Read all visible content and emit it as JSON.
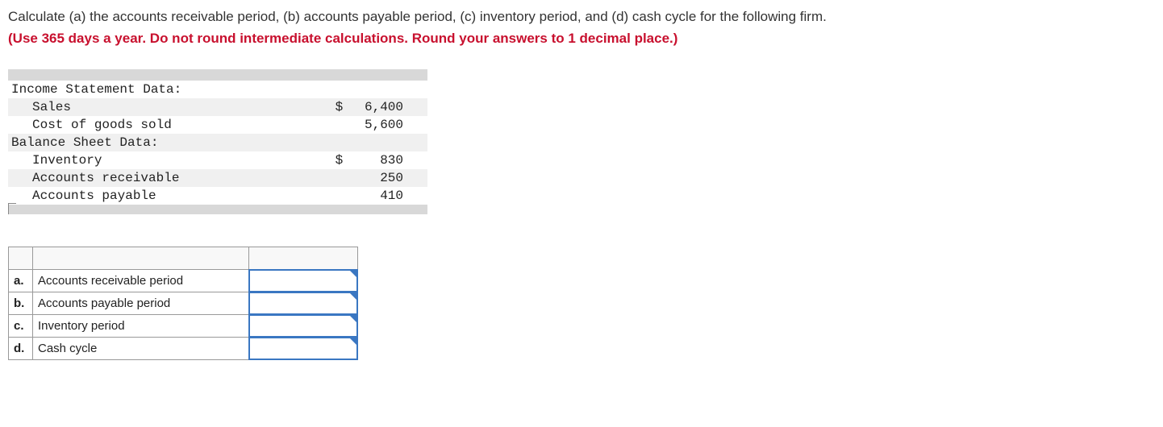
{
  "question": {
    "prompt": "Calculate (a) the accounts receivable period, (b) accounts payable period, (c) inventory period, and (d) cash cycle for the following firm.",
    "instruction": "(Use 365 days a year. Do not round intermediate calculations. Round your answers to 1 decimal place.)"
  },
  "data_table": {
    "sections": [
      {
        "header": "Income Statement Data:",
        "rows": [
          {
            "label": "Sales",
            "symbol": "$",
            "value": "6,400"
          },
          {
            "label": "Cost of goods sold",
            "symbol": "",
            "value": "5,600"
          }
        ]
      },
      {
        "header": "Balance Sheet Data:",
        "rows": [
          {
            "label": "Inventory",
            "symbol": "$",
            "value": "830"
          },
          {
            "label": "Accounts receivable",
            "symbol": "",
            "value": "250"
          },
          {
            "label": "Accounts payable",
            "symbol": "",
            "value": "410"
          }
        ]
      }
    ]
  },
  "answer_rows": [
    {
      "letter": "a.",
      "label": "Accounts receivable period",
      "value": ""
    },
    {
      "letter": "b.",
      "label": "Accounts payable period",
      "value": ""
    },
    {
      "letter": "c.",
      "label": "Inventory period",
      "value": ""
    },
    {
      "letter": "d.",
      "label": "Cash cycle",
      "value": ""
    }
  ]
}
